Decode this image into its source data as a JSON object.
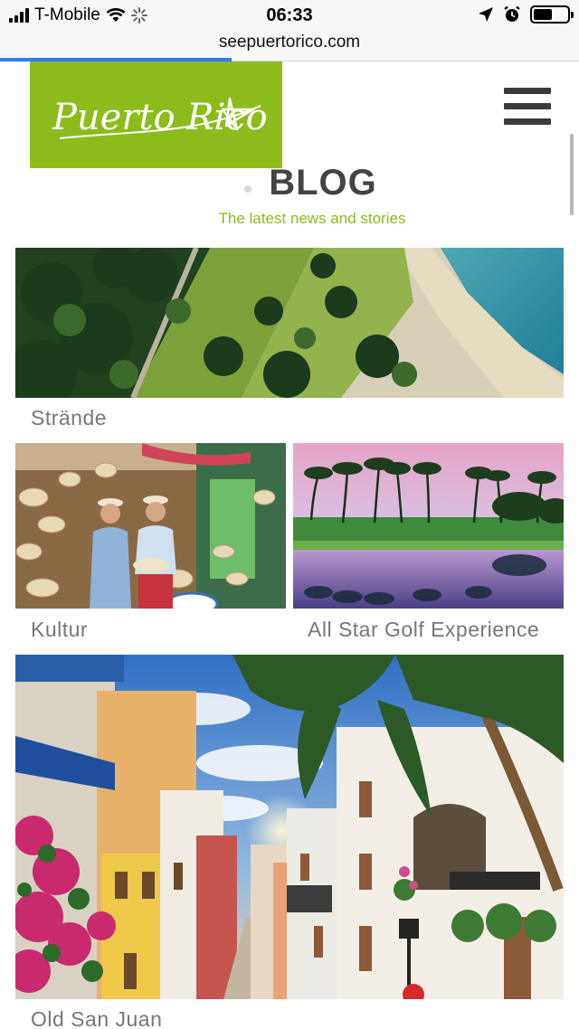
{
  "status_bar": {
    "carrier": "T-Mobile",
    "time": "06:33",
    "url": "seepuertorico.com",
    "page_load_progress": 0.4,
    "battery_level": 0.55
  },
  "header": {
    "logo_text": "Puerto Rico",
    "logo_color": "#8dbb1c",
    "menu_icon": "hamburger-icon"
  },
  "blog": {
    "title": "BLOG",
    "subtitle": "The latest news and stories",
    "accent_color": "#8dbb1c"
  },
  "posts": [
    {
      "caption": "Strände"
    },
    {
      "caption": "Kultur"
    },
    {
      "caption": "All Star Golf Experience"
    },
    {
      "caption": "Old San Juan"
    }
  ]
}
